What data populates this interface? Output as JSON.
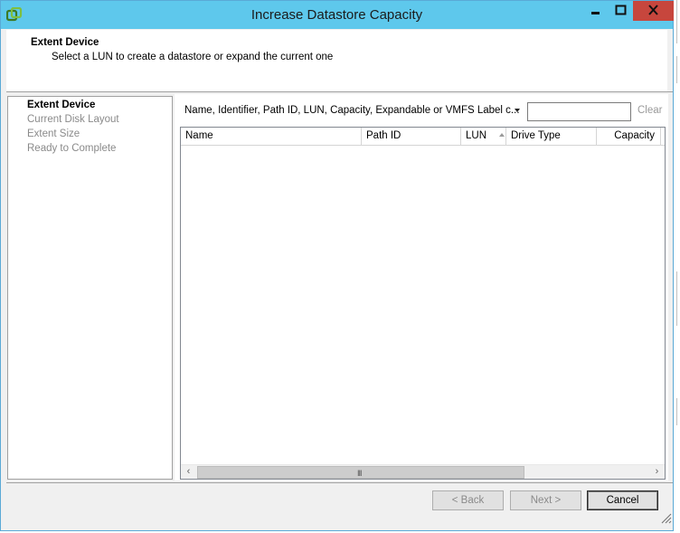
{
  "window": {
    "title": "Increase Datastore Capacity",
    "controls": {
      "minimize": "minimize-icon",
      "maximize": "maximize-icon",
      "close": "close-icon"
    }
  },
  "header": {
    "title": "Extent Device",
    "subtitle": "Select a LUN to create a datastore or expand the current one"
  },
  "steps": [
    {
      "label": "Extent Device",
      "active": true
    },
    {
      "label": "Current Disk Layout",
      "active": false
    },
    {
      "label": "Extent Size",
      "active": false
    },
    {
      "label": "Ready to Complete",
      "active": false
    }
  ],
  "filter": {
    "label": "Name, Identifier, Path ID, LUN, Capacity, Expandable or VMFS Label c...",
    "value": "",
    "clear": "Clear"
  },
  "table": {
    "columns": [
      "Name",
      "Path ID",
      "LUN",
      "Drive Type",
      "Capacity"
    ],
    "sorted_column": "LUN",
    "rows": []
  },
  "scrollbar": {
    "grip": "III"
  },
  "buttons": {
    "back": "< Back",
    "next": "Next >",
    "cancel": "Cancel"
  },
  "colors": {
    "titlebar": "#5ec8ec",
    "close": "#c7463d"
  }
}
